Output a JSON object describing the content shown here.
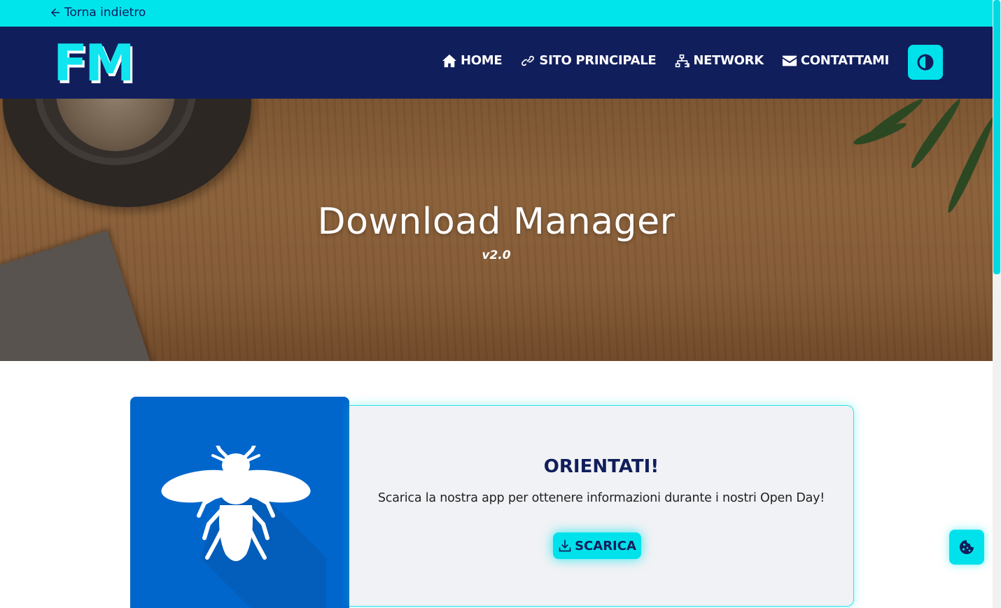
{
  "topbar": {
    "back_label": "Torna indietro",
    "back_icon": "arrow-left-icon"
  },
  "navbar": {
    "logo_text": "FM",
    "items": [
      {
        "label": "HOME",
        "icon": "home-icon"
      },
      {
        "label": "SITO PRINCIPALE",
        "icon": "link-icon"
      },
      {
        "label": "NETWORK",
        "icon": "network-icon"
      },
      {
        "label": "CONTATTAMI",
        "icon": "envelope-icon"
      }
    ],
    "theme_toggle_icon": "contrast-icon"
  },
  "hero": {
    "title": "Download Manager",
    "version": "v2.0"
  },
  "card": {
    "image_icon": "bee-icon",
    "title": "ORIENTATI!",
    "text": "Scarica la nostra app per ottenere informazioni durante i nostri Open Day!",
    "button_label": "SCARICA",
    "button_icon": "download-icon"
  },
  "cookie_button_icon": "cookie-icon",
  "colors": {
    "accent": "#00e2eb",
    "navy": "#111e5c",
    "card_blue": "#0066cc"
  }
}
